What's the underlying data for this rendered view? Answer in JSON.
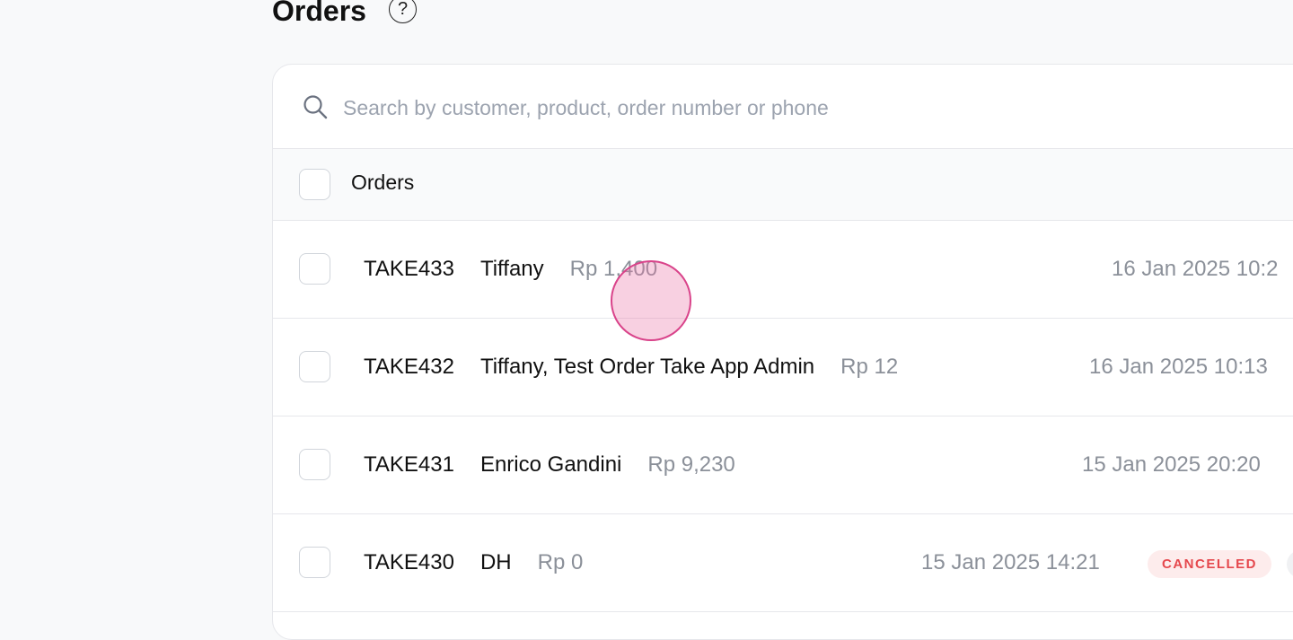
{
  "page": {
    "title": "Orders",
    "help_icon": "?"
  },
  "search": {
    "placeholder": "Search by customer, product, order number or phone",
    "value": ""
  },
  "table": {
    "header_label": "Orders",
    "rows": [
      {
        "order_no": "TAKE433",
        "customer": "Tiffany",
        "amount": "Rp 1,400",
        "date": "16 Jan 2025 10:2"
      },
      {
        "order_no": "TAKE432",
        "customer": "Tiffany, Test Order Take App Admin",
        "amount": "Rp 12",
        "date": "16 Jan 2025 10:13"
      },
      {
        "order_no": "TAKE431",
        "customer": "Enrico Gandini",
        "amount": "Rp 9,230",
        "date": "15 Jan 2025 20:20"
      },
      {
        "order_no": "TAKE430",
        "customer": "DH",
        "amount": "Rp 0",
        "date": "15 Jan 2025 14:21",
        "status": "CANCELLED"
      }
    ]
  },
  "colors": {
    "background": "#f8f9fa",
    "muted_text": "#8b9099",
    "cancelled_badge_bg": "#fdecec",
    "cancelled_badge_text": "#e5484d",
    "click_indicator": "#d9438a"
  }
}
